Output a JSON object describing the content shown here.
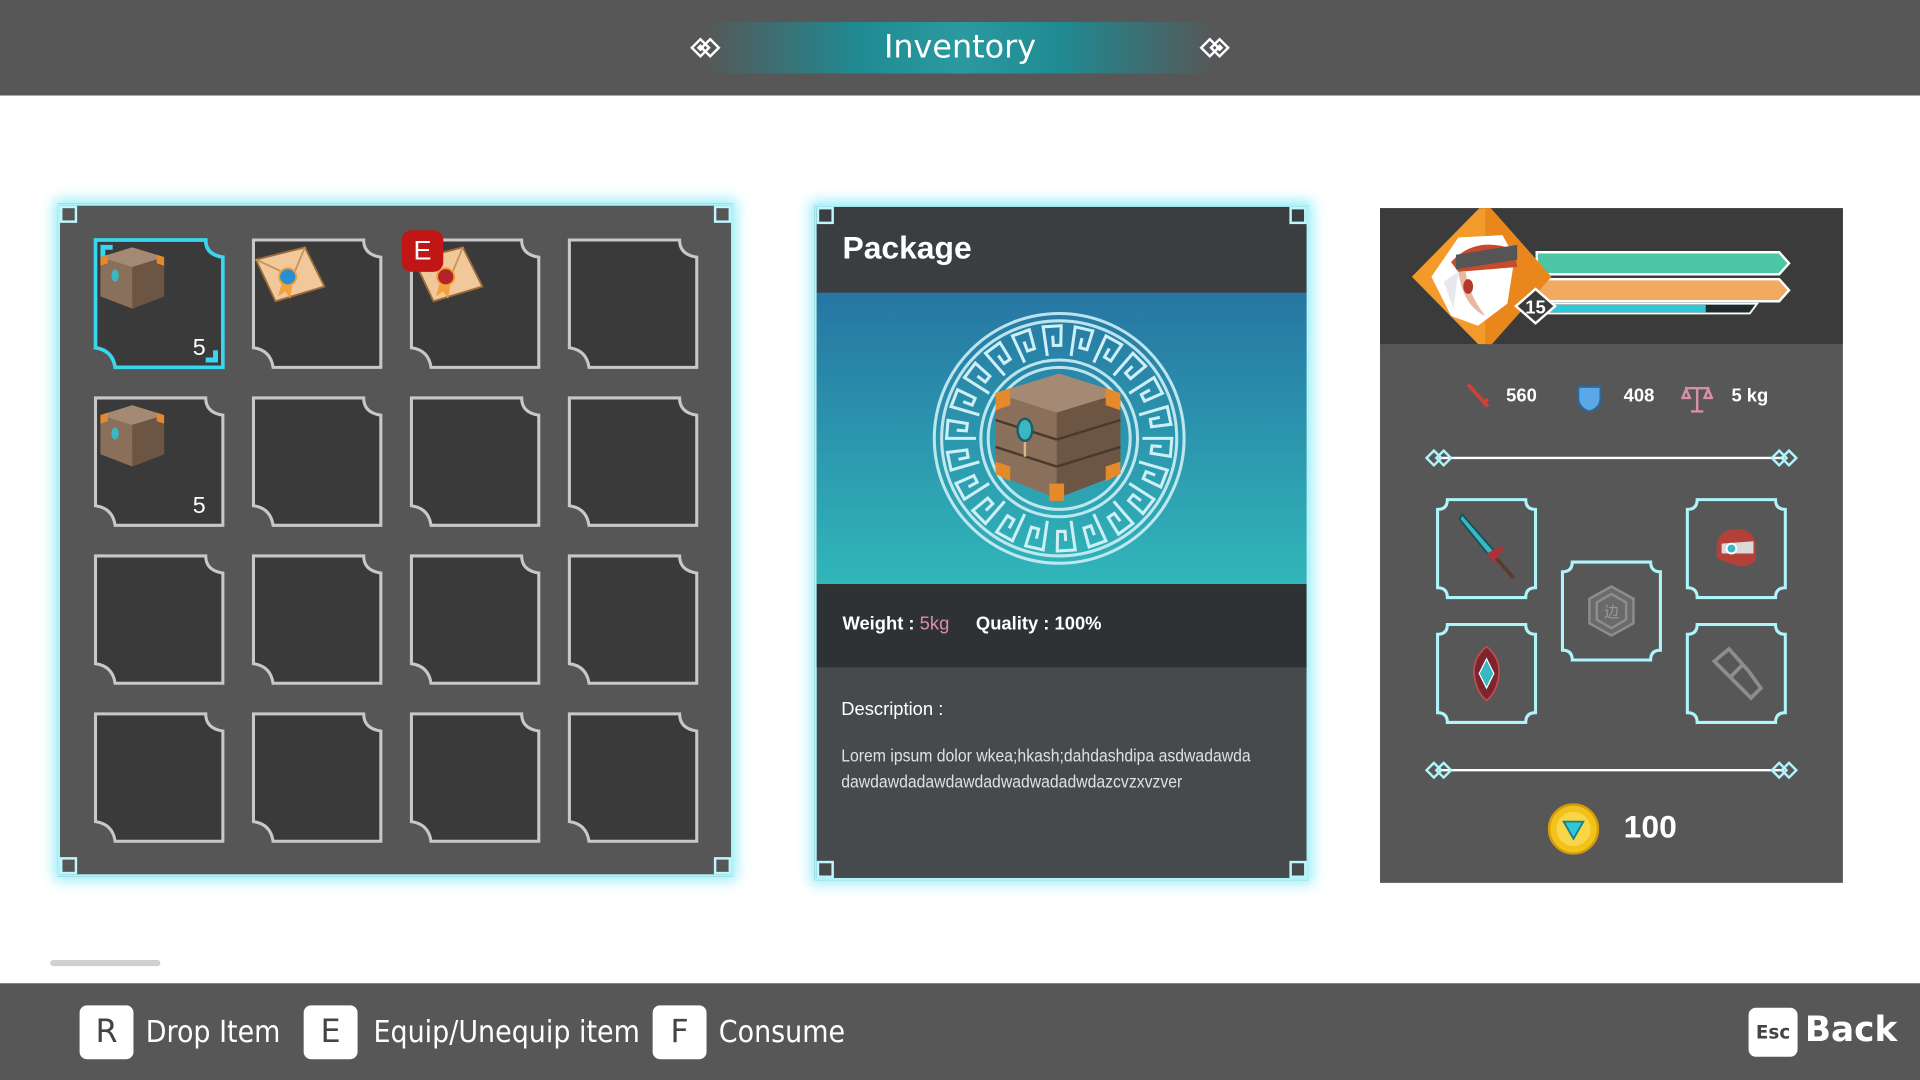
{
  "header": {
    "title": "Inventory"
  },
  "inventory": {
    "slots": [
      {
        "item": "package",
        "qty": "5",
        "selected": true,
        "equipped": false
      },
      {
        "item": "blue-seal-letter",
        "qty": "",
        "selected": false,
        "equipped": false
      },
      {
        "item": "red-seal-letter",
        "qty": "",
        "selected": false,
        "equipped": true,
        "badge": "E"
      },
      {
        "item": "",
        "qty": ""
      },
      {
        "item": "package",
        "qty": "5",
        "selected": false,
        "equipped": false
      },
      {
        "item": "",
        "qty": ""
      },
      {
        "item": "",
        "qty": ""
      },
      {
        "item": "",
        "qty": ""
      },
      {
        "item": "",
        "qty": ""
      },
      {
        "item": "",
        "qty": ""
      },
      {
        "item": "",
        "qty": ""
      },
      {
        "item": "",
        "qty": ""
      },
      {
        "item": "",
        "qty": ""
      },
      {
        "item": "",
        "qty": ""
      },
      {
        "item": "",
        "qty": ""
      },
      {
        "item": "",
        "qty": ""
      }
    ]
  },
  "detail": {
    "name": "Package",
    "weight_label": "Weight :",
    "weight_value": "5kg",
    "quality_label": "Quality :",
    "quality_value": "100%",
    "description_label": "Description :",
    "description_text": "Lorem ipsum dolor wkea;hkash;dahdashdipa asdwadawdadawdawdadawdawdadwadwadadwdazcvzxvzver"
  },
  "character": {
    "level": "15",
    "bars": {
      "health": 1.0,
      "stamina": 1.0,
      "experience": 0.75
    },
    "stats": {
      "attack": "560",
      "defense": "408",
      "weight": "5 kg"
    },
    "equipment": [
      "sword",
      "helmet",
      "empty-center",
      "shield-charm",
      "empty-boot"
    ],
    "coins": "100"
  },
  "colors": {
    "accent": "#aef4fb",
    "health": "#4cc6a6",
    "stamina": "#f2a962",
    "exp": "#2ec8d6",
    "equipped_badge": "#c01616",
    "pink": "#d88fa8"
  },
  "footer": {
    "actions": [
      {
        "key": "R",
        "label": "Drop Item"
      },
      {
        "key": "E",
        "label": "Equip/Unequip item"
      },
      {
        "key": "F",
        "label": "Consume"
      }
    ],
    "back": {
      "key": "Esc",
      "label": "Back"
    }
  }
}
